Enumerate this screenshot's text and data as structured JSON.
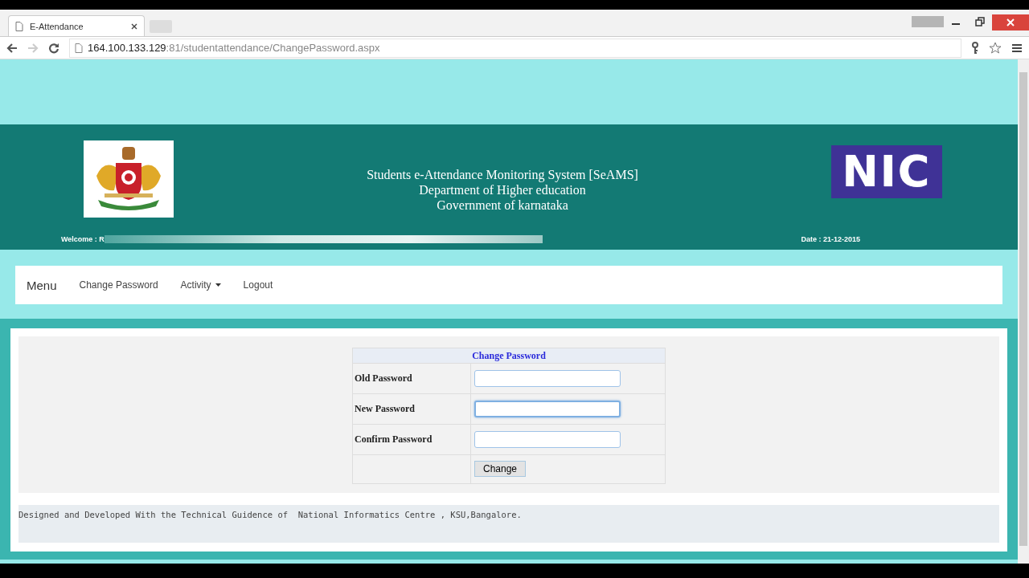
{
  "browser": {
    "tab": {
      "title": "E-Attendance",
      "selected": true
    },
    "address": {
      "host": "164.100.133.129",
      "rest": ":81/studentattendance/ChangePassword.aspx"
    }
  },
  "header": {
    "title_lines": [
      "Students e-Attendance Monitoring System [SeAMS]",
      "Department of Higher education",
      "Government of karnataka"
    ],
    "logo_text": "NIC",
    "welcome": "Welcome : R",
    "date": "Date : 21-12-2015"
  },
  "navbar": {
    "brand": "Menu",
    "items": [
      {
        "label": "Change Password",
        "dropdown": false
      },
      {
        "label": "Activity",
        "dropdown": true
      },
      {
        "label": "Logout",
        "dropdown": false
      }
    ]
  },
  "form": {
    "title": "Change Password",
    "fields": [
      {
        "label": "Old Password",
        "focused": false
      },
      {
        "label": "New Password",
        "focused": true
      },
      {
        "label": "Confirm Password",
        "focused": false
      }
    ],
    "button": "Change"
  },
  "footer": "Designed and Developed With the Technical Guidence of  National Informatics Centre , KSU,Bangalore."
}
